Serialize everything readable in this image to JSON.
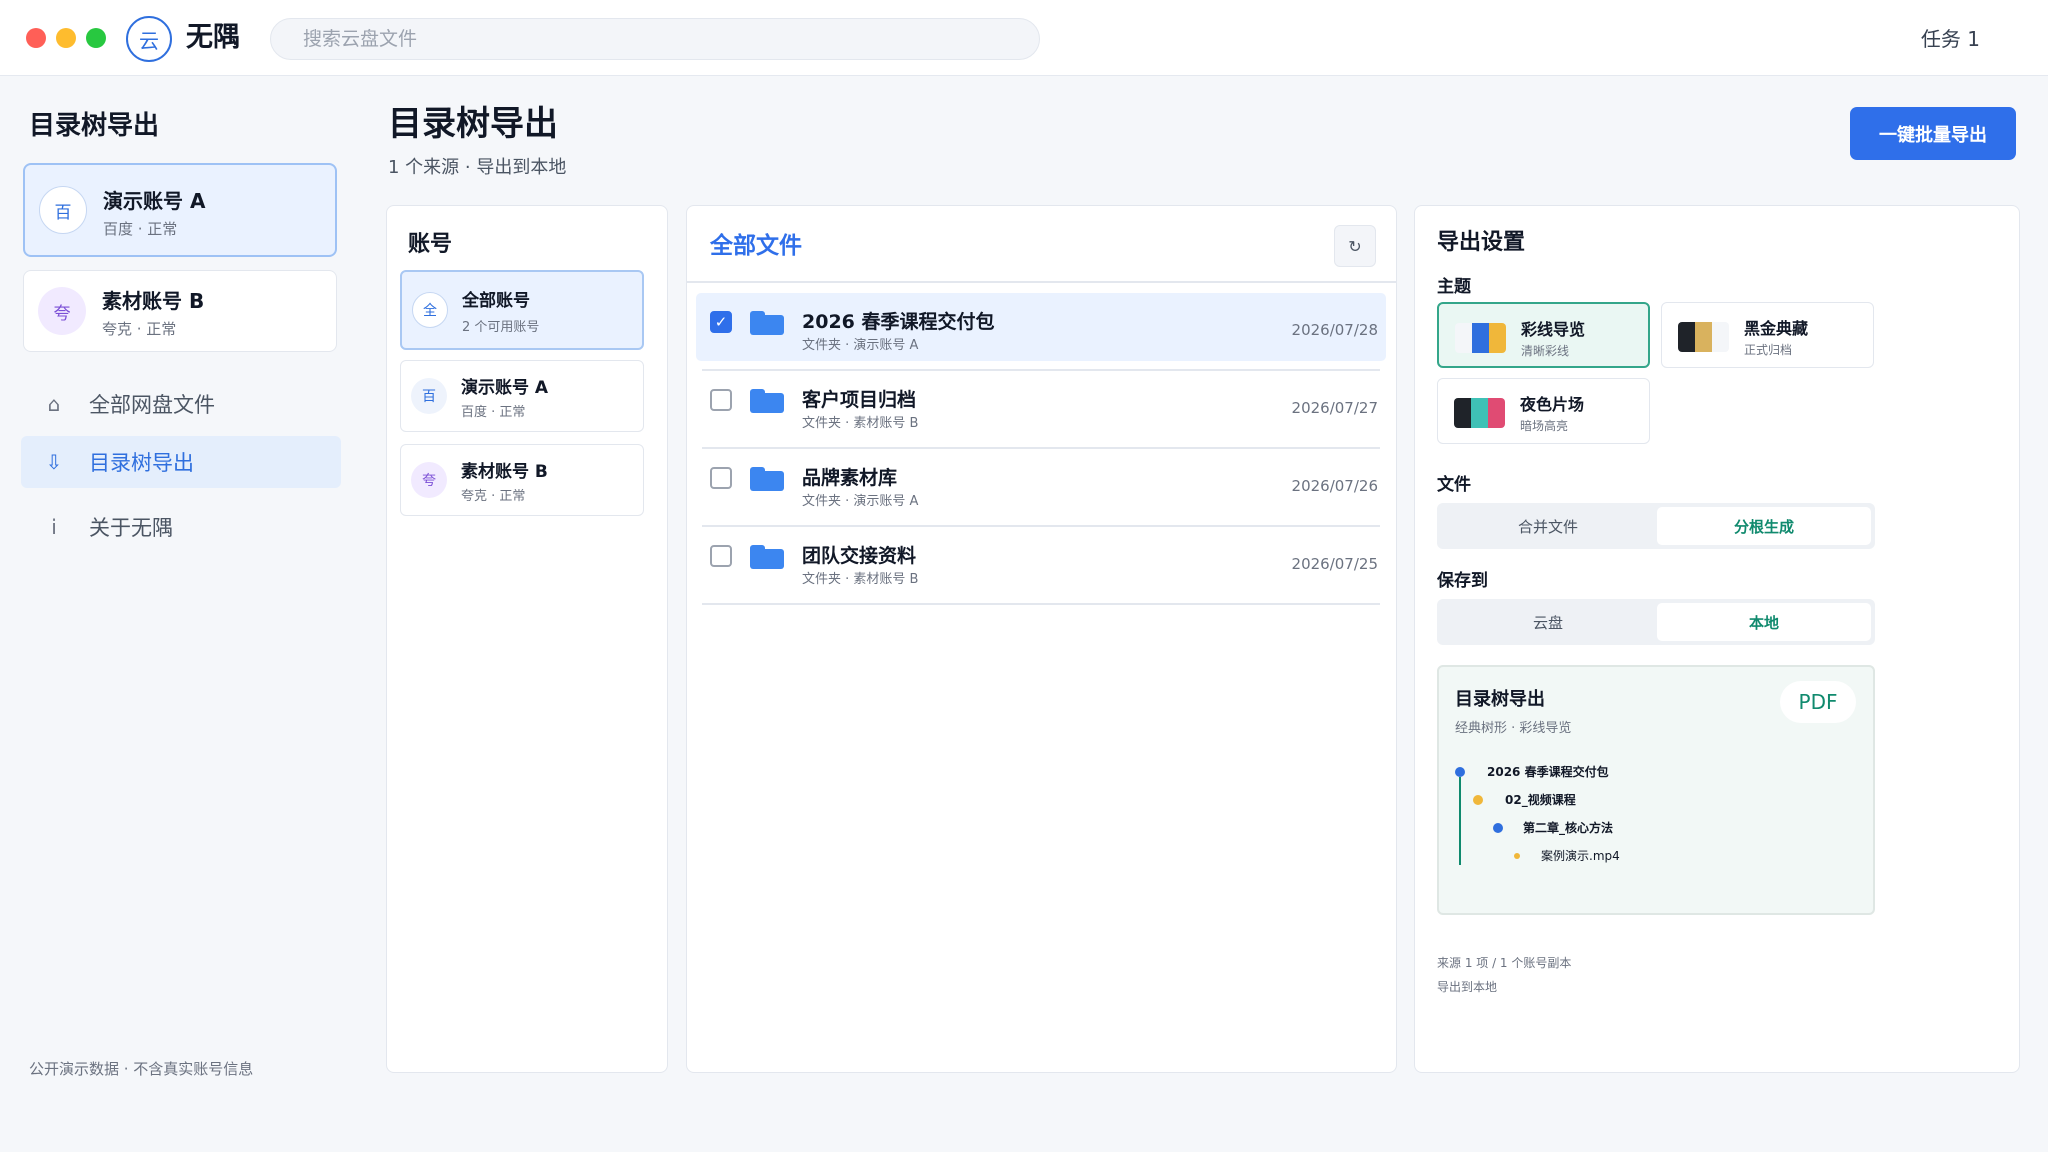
{
  "app": {
    "logo_glyph": "云",
    "name": "无隅",
    "search_placeholder": "搜索云盘文件",
    "task_label": "任务 1"
  },
  "sidebar": {
    "title": "目录树导出",
    "accounts": [
      {
        "avatar": "百",
        "name": "演示账号 A",
        "meta": "百度 · 正常",
        "active": true
      },
      {
        "avatar": "夸",
        "name": "素材账号 B",
        "meta": "夸克 · 正常",
        "active": false
      }
    ],
    "nav": [
      {
        "icon": "home-icon",
        "glyph": "⌂",
        "label": "全部网盘文件",
        "active": false
      },
      {
        "icon": "download-icon",
        "glyph": "⇩",
        "label": "目录树导出",
        "active": true
      },
      {
        "icon": "info-icon",
        "glyph": "i",
        "label": "关于无隅",
        "active": false
      }
    ],
    "footer": "公开演示数据 · 不含真实账号信息"
  },
  "main": {
    "title": "目录树导出",
    "subtitle": "1 个来源 · 导出到本地",
    "export_button": "一键批量导出"
  },
  "accounts_panel": {
    "title": "账号",
    "items": [
      {
        "avatar": "全",
        "name": "全部账号",
        "meta": "2 个可用账号",
        "active": true
      },
      {
        "avatar": "百",
        "name": "演示账号 A",
        "meta": "百度 · 正常",
        "active": false
      },
      {
        "avatar": "夸",
        "name": "素材账号 B",
        "meta": "夸克 · 正常",
        "active": false
      }
    ]
  },
  "files_panel": {
    "title": "全部文件",
    "refresh_glyph": "↻",
    "files": [
      {
        "name": "2026 春季课程交付包",
        "meta": "文件夹 · 演示账号 A",
        "date": "2026/07/28",
        "checked": true
      },
      {
        "name": "客户项目归档",
        "meta": "文件夹 · 素材账号 B",
        "date": "2026/07/27",
        "checked": false
      },
      {
        "name": "品牌素材库",
        "meta": "文件夹 · 演示账号 A",
        "date": "2026/07/26",
        "checked": false
      },
      {
        "name": "团队交接资料",
        "meta": "文件夹 · 素材账号 B",
        "date": "2026/07/25",
        "checked": false
      }
    ]
  },
  "settings": {
    "title": "导出设置",
    "theme_label": "主题",
    "themes": [
      {
        "name": "彩线导览",
        "meta": "清晰彩线",
        "colors": [
          "#f4f6f9",
          "#2f6fde",
          "#f0b73a"
        ],
        "active": true
      },
      {
        "name": "黑金典藏",
        "meta": "正式归档",
        "colors": [
          "#1f2329",
          "#d9b25e",
          "#f4f6f9"
        ],
        "active": false
      },
      {
        "name": "夜色片场",
        "meta": "暗场高亮",
        "colors": [
          "#1f2329",
          "#3fc1b6",
          "#e04b73"
        ],
        "active": false
      }
    ],
    "file_label": "文件",
    "file_options": [
      "合并文件",
      "分根生成"
    ],
    "file_selected": "分根生成",
    "save_label": "保存到",
    "save_options": [
      "云盘",
      "本地"
    ],
    "save_selected": "本地",
    "preview": {
      "title": "目录树导出",
      "subtitle": "经典树形 · 彩线导览",
      "format": "PDF",
      "nodes": [
        {
          "label": "2026 春季课程交付包",
          "level": 0,
          "color": "#2f6fde"
        },
        {
          "label": "02_视频课程",
          "level": 1,
          "color": "#f0b73a"
        },
        {
          "label": "第二章_核心方法",
          "level": 2,
          "color": "#2f6fde"
        },
        {
          "label": "案例演示.mp4",
          "level": 3,
          "color": "#f0b73a"
        }
      ]
    },
    "footer_lines": [
      "来源 1 项 / 1 个账号副本",
      "导出到本地"
    ]
  }
}
